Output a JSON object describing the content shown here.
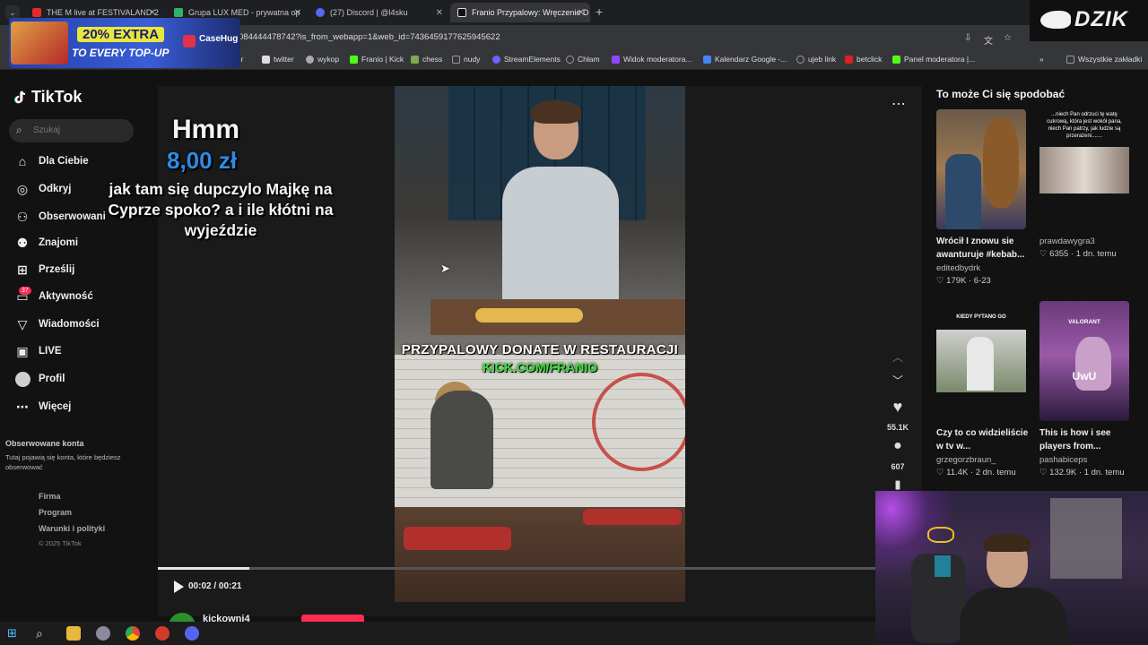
{
  "browser": {
    "tabs": [
      {
        "title": "THE M live at FESTIVALAND 2 (",
        "color": "#e02b2b"
      },
      {
        "title": "Grupa LUX MED - prywatna op",
        "color": "#2fb36b"
      },
      {
        "title": "(27) Discord | @l4sku",
        "color": "#5865f2"
      },
      {
        "title": "Franio Przypalowy: Wręczenie D",
        "color": "#ffffff",
        "active": true
      }
    ],
    "url": "084444478742?is_from_webapp=1&web_id=7436459177625945622",
    "bookmarks": [
      {
        "label": "twitter",
        "color": "#dddddd"
      },
      {
        "label": "wykop",
        "color": "#aaaaaa"
      },
      {
        "label": "Franio | Kick",
        "color": "#53fc18"
      },
      {
        "label": "chess",
        "color": "#7fa650"
      },
      {
        "label": "nudy",
        "color": "#999999"
      },
      {
        "label": "StreamElements",
        "color": "#6c63ff"
      },
      {
        "label": "Chłam",
        "color": "#999999"
      },
      {
        "label": "Widok moderatora...",
        "color": "#9146ff"
      },
      {
        "label": "Kalendarz Google -...",
        "color": "#4285f4"
      },
      {
        "label": "ujeb link",
        "color": "#999999"
      },
      {
        "label": "betclick",
        "color": "#e02020"
      },
      {
        "label": "Panel moderatora |...",
        "color": "#53fc18"
      }
    ],
    "bookmarks_more": "»",
    "all_bookmarks": "Wszystkie zakładki",
    "partial_bookmark": "lior"
  },
  "ad": {
    "line1": "20% EXTRA",
    "line2": "TO EVERY TOP-UP",
    "brand": "CaseHug"
  },
  "overlay_logo": "DZIK",
  "tiktok": {
    "logo": "TikTok",
    "search_placeholder": "Szukaj",
    "nav": [
      {
        "label": "Dla Ciebie",
        "icon": "home-icon"
      },
      {
        "label": "Odkryj",
        "icon": "compass-icon"
      },
      {
        "label": "Obserwowani",
        "icon": "following-icon"
      },
      {
        "label": "Znajomi",
        "icon": "friends-icon"
      },
      {
        "label": "Prześlij",
        "icon": "upload-icon"
      },
      {
        "label": "Aktywność",
        "icon": "activity-icon"
      },
      {
        "label": "Wiadomości",
        "icon": "messages-icon"
      },
      {
        "label": "LIVE",
        "icon": "live-icon"
      },
      {
        "label": "Profil",
        "icon": "profile-icon"
      },
      {
        "label": "Więcej",
        "icon": "more-icon"
      }
    ],
    "activity_badge": "37",
    "followed_accounts_title": "Obserwowane konta",
    "followed_accounts_desc": "Tutaj pojawią się konta, które będziesz obserwować",
    "footer": [
      "Firma",
      "Program",
      "Warunki i polityki"
    ],
    "copyright": "© 2025 TikTok"
  },
  "donation": {
    "header": "Hmm",
    "amount": "8,00 zł",
    "message": "jak tam się dupczylo Majkę na Cyprze spoko? a i ile kłótni na wyjeździe"
  },
  "video": {
    "caption_line1": "PRZYPALOWY DONATE W RESTAURACJI",
    "caption_line2": "KICK.COM/FRANIO",
    "time": "00:02 / 00:21",
    "progress": 0.12,
    "author": "kickowni4",
    "likes": "55.1K",
    "comments": "607"
  },
  "suggestions": {
    "title": "To może Ci się spodobać",
    "items": [
      {
        "title": "Wrócił I znowu sie awanturuje #kebab...",
        "author": "editedbydrk",
        "stats": "♡ 179K · 6-23",
        "thumb_text": ""
      },
      {
        "title": "",
        "author": "prawdawygra3",
        "stats": "♡ 6355 · 1 dn. temu",
        "thumb_text": "...niech Pan odrzuci tę watę cukrową, która jest wokół pana, niech Pan patrzy, jak ludzie są przerażeni......."
      },
      {
        "title": "Czy to co widzieliście w tv w...",
        "author": "grzegorzbraun_",
        "stats": "♡ 11.4K · 2 dn. temu",
        "thumb_text": "KIEDY PYTANO GO"
      },
      {
        "title": "This is how i see players from...",
        "author": "pashabiceps",
        "stats": "♡ 132.9K · 1 dn. temu",
        "thumb_text": "UwU",
        "thumb_tag": "VALORANT"
      }
    ]
  }
}
